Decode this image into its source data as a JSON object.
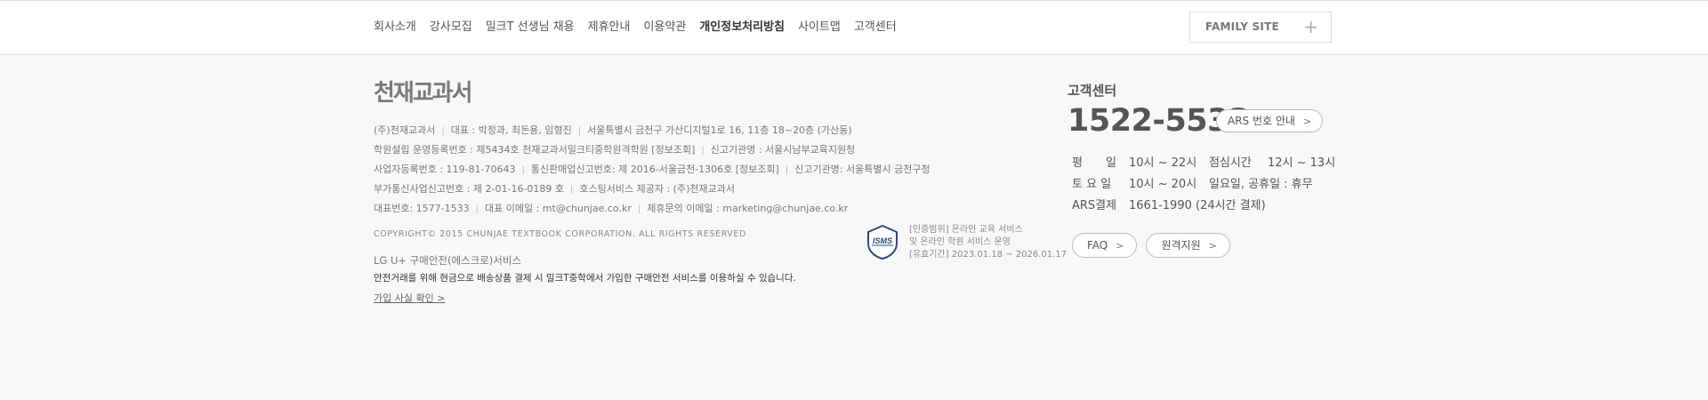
{
  "nav": {
    "items": [
      {
        "label": "회사소개"
      },
      {
        "label": "강사모집"
      },
      {
        "label": "밀크T 선생님 채용"
      },
      {
        "label": "제휴안내"
      },
      {
        "label": "이용약관"
      },
      {
        "label": "개인정보처리방침"
      },
      {
        "label": "사이트맵"
      },
      {
        "label": "고객센터"
      }
    ]
  },
  "family_site": {
    "label": "FAMILY SITE",
    "icon": "plus-icon"
  },
  "logo": {
    "text": "천재교과서"
  },
  "company": {
    "rows": [
      [
        "(주)천재교과서",
        "대표 : 박정과, 최돈용, 임형진",
        "서울특별시 금천구 가산디지털1로 16, 11층 18~20층 (가산동)"
      ],
      [
        "학원설립 운영등록번호 : 제5434호 천재교과서밀크티중학원격학원 [정보조회]",
        "신고기관명 : 서울시남부교육지원청"
      ],
      [
        "사업자등록번호 : 119-81-70643",
        "통신판매업신고번호: 제 2016-서울금천-1306호 [정보조회]",
        "신고기관명: 서울특별시 금천구청"
      ],
      [
        "부가통신사업신고번호 : 제 2-01-16-0189 호",
        "호스팅서비스 제공자 : (주)천재교과서"
      ],
      [
        "대표번호: 1577-1533",
        "대표 이메일 : mt@chunjae.co.kr",
        "제휴문의 이메일 : marketing@chunjae.co.kr"
      ]
    ]
  },
  "copyright": "COPYRIGHT© 2015 CHUNJAE TEXTBOOK CORPORATION. ALL RIGHTS RESERVED",
  "isms": {
    "badge": "ISMS",
    "lines": [
      "[인증범위] 온라인 교육 서비스",
      "및 온라인 학원 서비스 운영",
      "[유효기간] 2023.01.18 ~ 2026.01.17"
    ]
  },
  "lg_escrow": {
    "title": "LG U+ 구매안전(에스크로)서비스",
    "desc": "안전거래를 위해 현금으로 배송상품 결제 시 밀크T중학에서 가입한 구매안전 서비스를 이용하실 수 있습니다.",
    "link": "가입 사실 확인 >"
  },
  "customer_center": {
    "title": "고객센터",
    "phone": "1522-5533",
    "ars_button": "ARS 번호 안내",
    "hours": [
      [
        "평　　일",
        "10시 ~ 22시",
        "점심시간",
        "12시 ~ 13시"
      ],
      [
        "토 요 일",
        "10시 ~ 20시",
        "일요일, 공휴일 : 휴무",
        ""
      ],
      [
        "ARS결제",
        "1661-1990 (24시간 결제)",
        "",
        ""
      ]
    ],
    "buttons": [
      {
        "label": "FAQ"
      },
      {
        "label": "원격지원"
      }
    ]
  },
  "colors": {
    "background": "#f8f8f8",
    "text": "#666666",
    "heading": "#555555"
  }
}
